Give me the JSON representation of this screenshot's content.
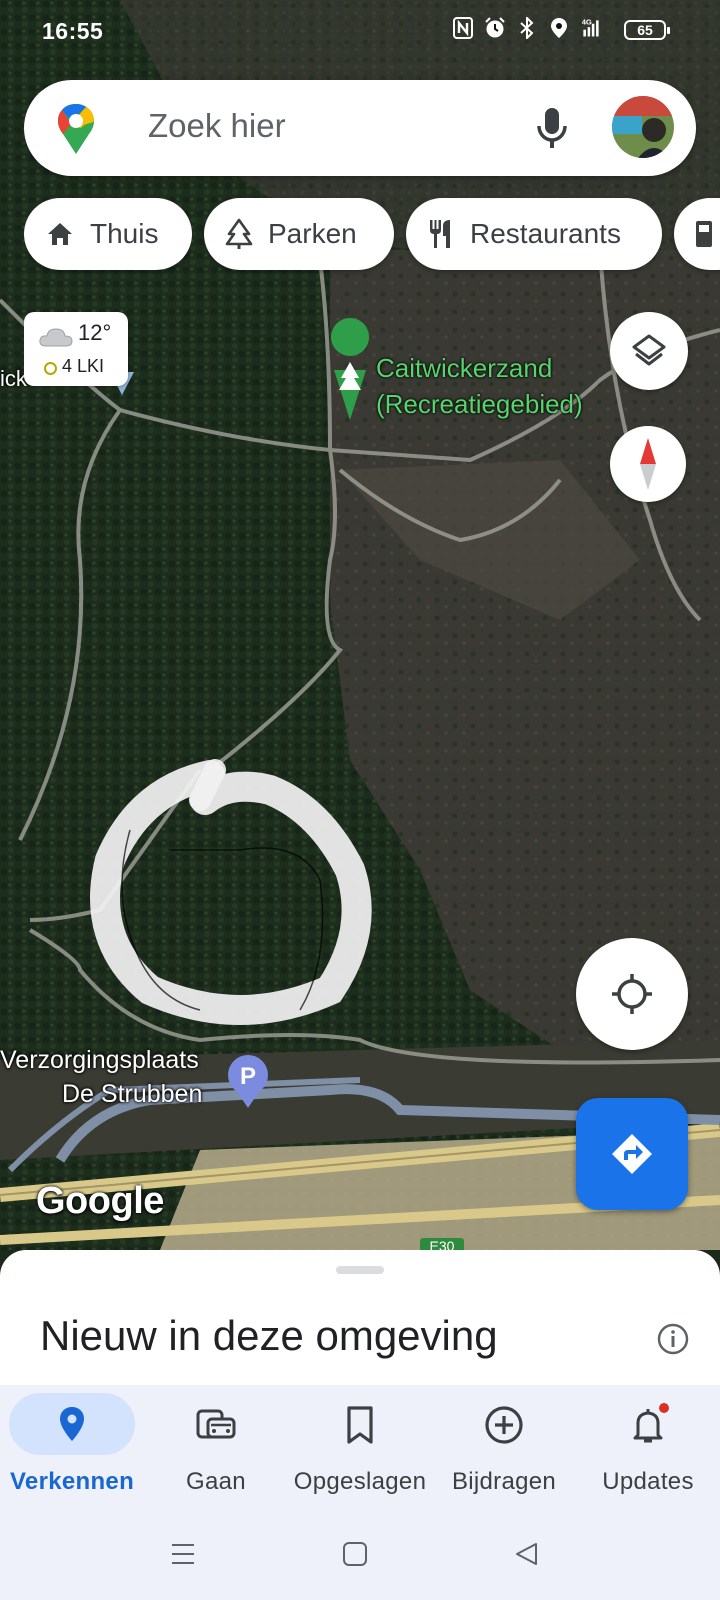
{
  "status_bar": {
    "time": "16:55",
    "icons": [
      "nfc-icon",
      "alarm-icon",
      "bluetooth-icon",
      "location-icon",
      "signal-4g-icon"
    ],
    "network": "4G",
    "battery": "65"
  },
  "search": {
    "placeholder": "Zoek hier",
    "icons": [
      "google-maps-pin-icon",
      "microphone-icon",
      "avatar"
    ]
  },
  "chips": [
    {
      "label": "Thuis",
      "icon": "home-icon"
    },
    {
      "label": "Parken",
      "icon": "tree-icon"
    },
    {
      "label": "Restaurants",
      "icon": "restaurant-icon"
    },
    {
      "label": "",
      "icon": "gas-station-icon"
    }
  ],
  "weather": {
    "temperature": "12°",
    "air_quality": "4 LKI",
    "icon": "cloud-icon"
  },
  "map": {
    "labels": {
      "park_line1": "Caitwickerzand",
      "park_line2": "(Recreatiegebied)",
      "rest_area_line1": "Verzorgingsplaats",
      "rest_area_line2": "De Strubben",
      "partial_left": "ick",
      "road_shield": "E30"
    },
    "attribution": "Google",
    "colors": {
      "park_label": "#57d46b",
      "parking_pin": "#7b8ce0",
      "directions": "#1a73e8"
    }
  },
  "sheet": {
    "title": "Nieuw in deze omgeving"
  },
  "bottom_nav": [
    {
      "label": "Verkennen",
      "icon": "explore-pin-icon",
      "active": true
    },
    {
      "label": "Gaan",
      "icon": "commute-icon",
      "active": false
    },
    {
      "label": "Opgeslagen",
      "icon": "bookmark-icon",
      "active": false
    },
    {
      "label": "Bijdragen",
      "icon": "add-circle-icon",
      "active": false
    },
    {
      "label": "Updates",
      "icon": "bell-icon",
      "active": false,
      "badge": true
    }
  ],
  "system_nav": [
    "menu-icon",
    "home-square-icon",
    "back-triangle-icon"
  ]
}
